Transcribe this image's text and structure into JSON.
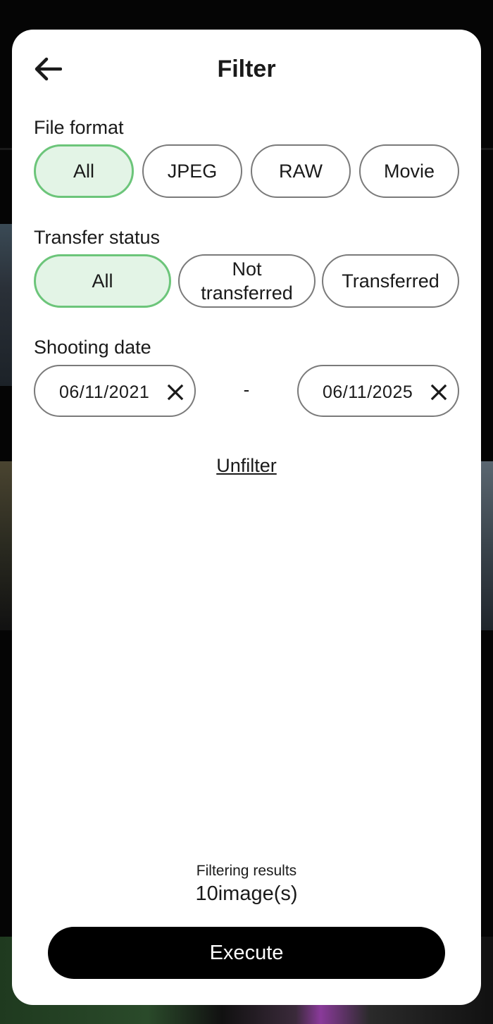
{
  "header": {
    "title": "Filter",
    "back_icon": "arrow-left-icon"
  },
  "file_format": {
    "label": "File format",
    "options": [
      "All",
      "JPEG",
      "RAW",
      "Movie"
    ],
    "selected": "All"
  },
  "transfer_status": {
    "label": "Transfer status",
    "options": [
      "All",
      "Not transferred",
      "Transferred"
    ],
    "selected": "All"
  },
  "shooting_date": {
    "label": "Shooting date",
    "start": "06/11/2021",
    "separator": "-",
    "end": "06/11/2025",
    "clear_icon": "close-icon"
  },
  "unfilter_label": "Unfilter",
  "results": {
    "label": "Filtering results",
    "count": "10image(s)"
  },
  "execute_label": "Execute",
  "colors": {
    "selected_border": "#6cc57a",
    "selected_fill": "#e3f4e6",
    "button": "#000000"
  }
}
